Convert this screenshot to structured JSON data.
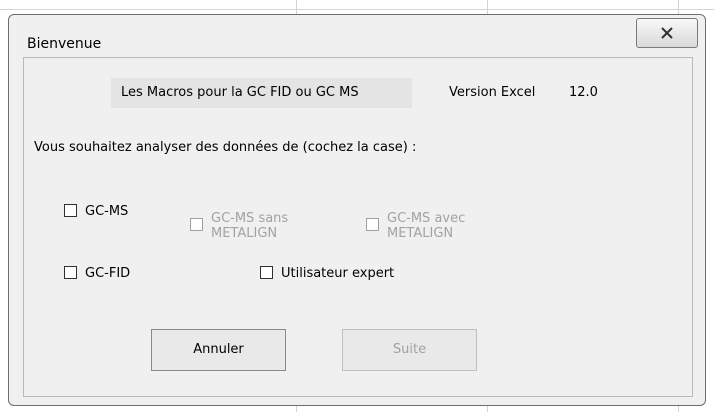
{
  "dialog": {
    "title": "Bienvenue",
    "close_icon": "close-x-icon"
  },
  "header": {
    "macros_label": "Les Macros pour la GC FID ou GC MS",
    "version_label": "Version Excel",
    "version_value": "12.0"
  },
  "prompt": "Vous souhaitez analyser des données de (cochez la case) :",
  "options": {
    "gc_ms": {
      "label": "GC-MS",
      "checked": false,
      "enabled": true
    },
    "gc_ms_sans": {
      "label": "GC-MS sans\nMETALIGN",
      "checked": false,
      "enabled": false
    },
    "gc_ms_avec": {
      "label": "GC-MS avec\nMETALIGN",
      "checked": false,
      "enabled": false
    },
    "gc_fid": {
      "label": "GC-FID",
      "checked": false,
      "enabled": true
    },
    "expert": {
      "label": "Utilisateur expert",
      "checked": false,
      "enabled": true
    }
  },
  "buttons": {
    "cancel": "Annuler",
    "next": "Suite"
  }
}
